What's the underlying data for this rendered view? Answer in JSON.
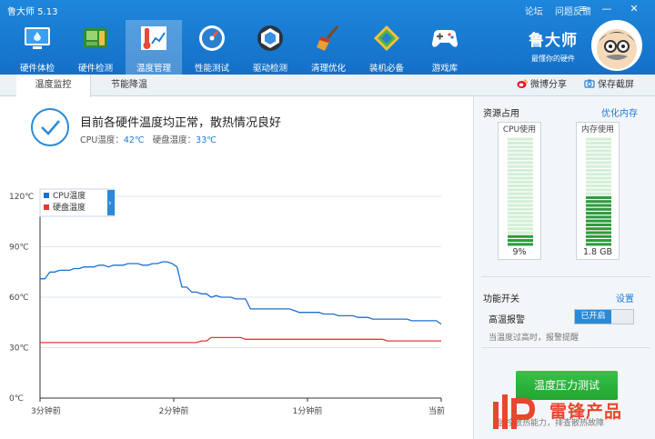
{
  "app": {
    "title": "鲁大师 5.13",
    "brand_name": "鲁大师",
    "brand_slogan": "最懂你的硬件"
  },
  "header_links": [
    "论坛",
    "问题反馈"
  ],
  "window_controls": {
    "menu": "≡",
    "min": "—",
    "close": "✕"
  },
  "toolbar": [
    {
      "label": "硬件体检",
      "icon": "hardware-check-icon"
    },
    {
      "label": "硬件检测",
      "icon": "hardware-detect-icon"
    },
    {
      "label": "温度管理",
      "icon": "temperature-icon",
      "active": true
    },
    {
      "label": "性能测试",
      "icon": "performance-icon"
    },
    {
      "label": "驱动检测",
      "icon": "driver-icon"
    },
    {
      "label": "清理优化",
      "icon": "broom-icon"
    },
    {
      "label": "装机必备",
      "icon": "software-box-icon"
    },
    {
      "label": "游戏库",
      "icon": "gamepad-icon"
    }
  ],
  "tabs": [
    {
      "label": "温度监控",
      "active": true
    },
    {
      "label": "节能降温",
      "active": false
    }
  ],
  "share": {
    "weibo": "微博分享",
    "screenshot": "保存截屏"
  },
  "status": {
    "message": "目前各硬件温度均正常，散热情况良好",
    "cpu_label": "CPU温度：",
    "cpu_value": "42℃",
    "disk_label": "硬盘温度：",
    "disk_value": "33℃"
  },
  "chart_data": {
    "type": "line",
    "y_ticks": [
      "0℃",
      "30℃",
      "60℃",
      "90℃",
      "120℃"
    ],
    "ylim": [
      0,
      120
    ],
    "x_ticks": [
      "3分钟前",
      "2分钟前",
      "1分钟前",
      "当前"
    ],
    "legend": [
      "CPU温度",
      "硬盘温度"
    ],
    "legend_placement": "top-left",
    "grid": true,
    "series": [
      {
        "name": "CPU温度",
        "color": "#1f6fd0",
        "values": [
          71,
          71,
          75,
          75,
          76,
          76,
          76,
          77,
          77,
          78,
          78,
          78,
          79,
          79,
          78,
          79,
          79,
          79,
          80,
          80,
          80,
          79,
          79,
          80,
          80,
          81,
          81,
          80,
          78,
          66,
          66,
          63,
          63,
          62,
          62,
          60,
          61,
          60,
          60,
          60,
          59,
          59,
          59,
          53,
          53,
          53,
          53,
          53,
          53,
          53,
          53,
          53,
          52,
          51,
          51,
          51,
          51,
          51,
          50,
          50,
          50,
          49,
          49,
          49,
          49,
          48,
          48,
          48,
          47,
          47,
          47,
          47,
          47,
          47,
          47,
          47,
          46,
          46,
          46,
          46,
          46,
          46,
          44
        ]
      },
      {
        "name": "硬盘温度",
        "color": "#e53935",
        "values": [
          33,
          33,
          33,
          33,
          33,
          33,
          33,
          33,
          33,
          33,
          33,
          33,
          33,
          33,
          33,
          33,
          33,
          33,
          33,
          33,
          33,
          33,
          33,
          33,
          33,
          33,
          33,
          33,
          33,
          33,
          33,
          33,
          33,
          34,
          34,
          36,
          36,
          36,
          36,
          36,
          36,
          36,
          35,
          35,
          35,
          35,
          35,
          35,
          35,
          35,
          35,
          35,
          35,
          35,
          35,
          35,
          35,
          35,
          35,
          35,
          35,
          35,
          35,
          35,
          35,
          35,
          35,
          35,
          35,
          35,
          35,
          34,
          34,
          34,
          34,
          34,
          34,
          34,
          34,
          34,
          34,
          34,
          34
        ]
      }
    ]
  },
  "side": {
    "resources_title": "资源占用",
    "optimize_link": "优化内存",
    "cpu_meter": {
      "label": "CPU使用",
      "value_text": "9%",
      "fraction": 0.09
    },
    "mem_meter": {
      "label": "内存使用",
      "value_text": "1.8 GB",
      "fraction": 0.46
    },
    "features_title": "功能开关",
    "settings_link": "设置",
    "alarm_label": "高温报警",
    "alarm_state": "已开启",
    "alarm_hint": "当温度过高时，报警提醒",
    "stress_button": "温度压力测试",
    "stress_hint": "监控散热能力，排查散热故障"
  },
  "watermark": "雷锋产品"
}
